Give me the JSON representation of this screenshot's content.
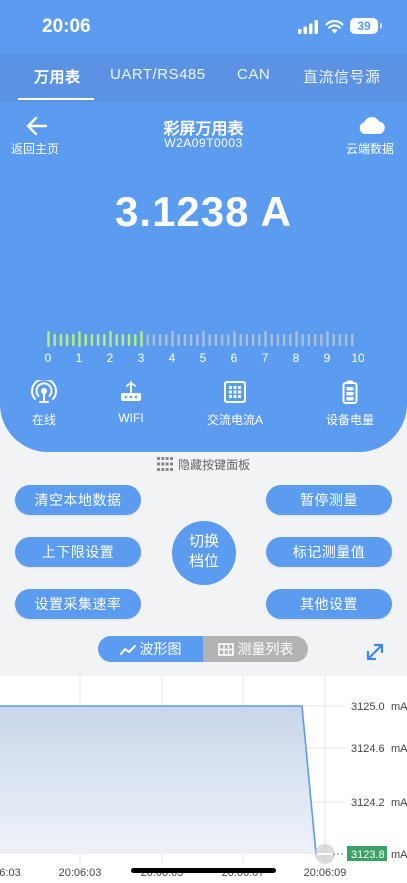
{
  "status": {
    "time": "20:06",
    "battery": "39"
  },
  "tabs": [
    {
      "label": "万用表",
      "active": true
    },
    {
      "label": "UART/RS485",
      "active": false
    },
    {
      "label": "CAN",
      "active": false
    },
    {
      "label": "直流信号源",
      "active": false
    }
  ],
  "header": {
    "back_label": "返回主页",
    "title": "彩屏万用表",
    "device_id": "W2A09T0003",
    "cloud_label": "云端数据"
  },
  "reading": "3.1238 A",
  "scale": {
    "labels": [
      "0",
      "1",
      "2",
      "3",
      "4",
      "5",
      "6",
      "7",
      "8",
      "9",
      "10"
    ],
    "max": 10,
    "value": 3.1238,
    "active_color": "#b6f07a",
    "inactive_color": "#aebfd2"
  },
  "indicators": [
    {
      "icon": "online-signal-icon",
      "label": "在线"
    },
    {
      "icon": "wifi-router-icon",
      "label": "WIFI"
    },
    {
      "icon": "ac-current-grid-icon",
      "label": "交流电流A"
    },
    {
      "icon": "battery-icon",
      "label": "设备电量"
    }
  ],
  "hide_panel_label": "隐藏按键面板",
  "buttons": {
    "clear_local": "清空本地数据",
    "pause": "暂停测量",
    "limits": "上下限设置",
    "mark": "标记测量值",
    "rate": "设置采集速率",
    "other": "其他设置",
    "switch_line1": "切换",
    "switch_line2": "档位"
  },
  "view_toggle": {
    "waveform": "波形图",
    "list": "测量列表"
  },
  "chart_data": {
    "type": "line",
    "x": [
      "20:06:03",
      "20:06:04",
      "20:06:05",
      "20:06:06",
      "20:06:07",
      "20:06:08",
      "20:06:09"
    ],
    "y": [
      3125.0,
      3125.0,
      3125.0,
      3125.0,
      3125.0,
      3125.0,
      3123.8
    ],
    "x_tick_labels": [
      "6:03",
      "20:06:03",
      "20:06:05",
      "20:06:07",
      "20:06:09"
    ],
    "y_tick_labels": [
      "3125.0",
      "3124.6",
      "3124.2"
    ],
    "y_unit": "mA",
    "ylim": [
      3123.8,
      3125.0
    ],
    "current_value_label": "3123.8",
    "line_color": "#5b9bf0",
    "fill_color": "#dbe5f2",
    "grid": true
  }
}
